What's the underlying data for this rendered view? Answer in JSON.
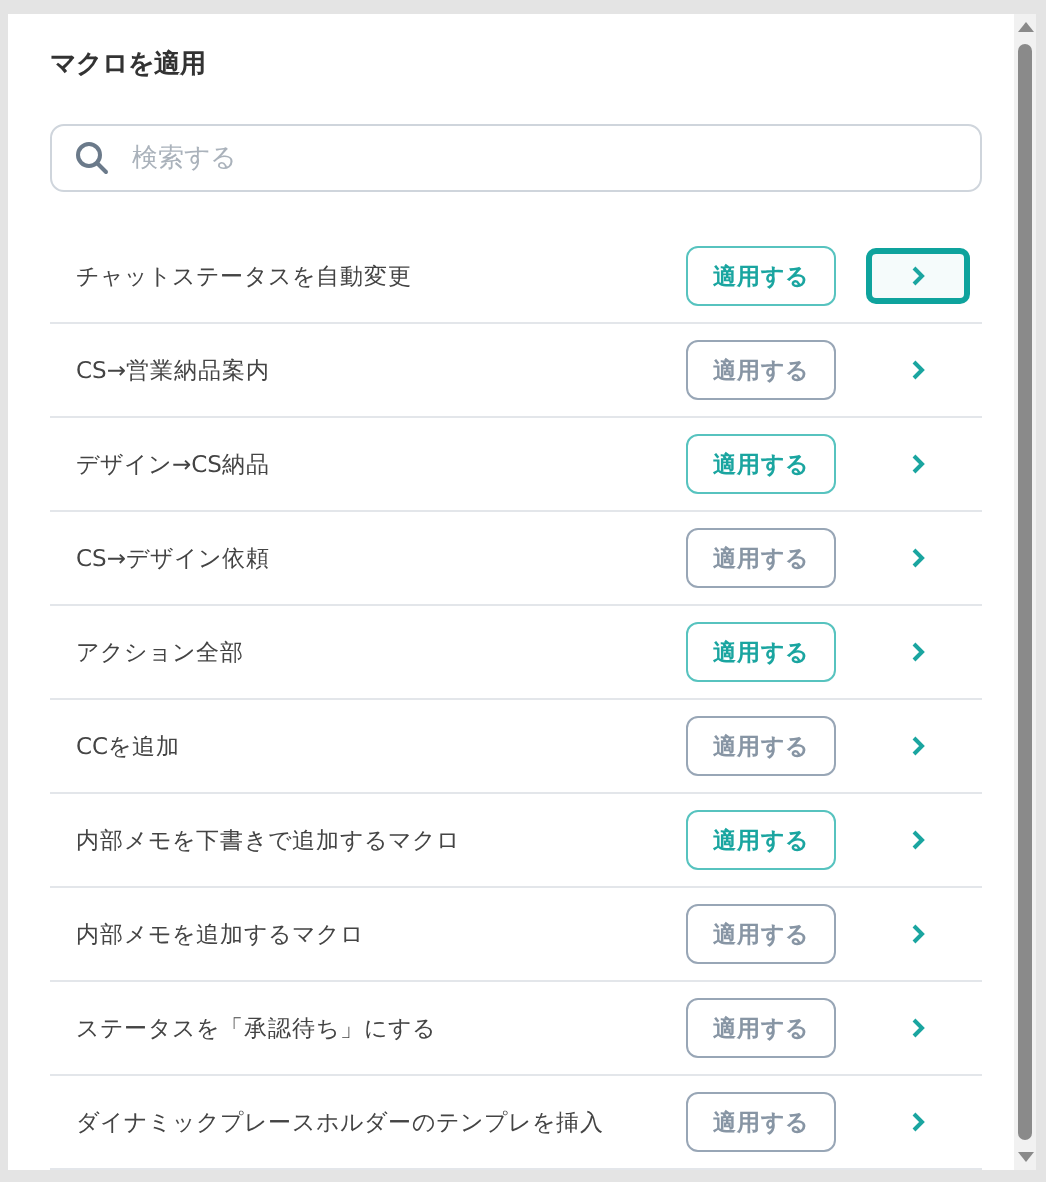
{
  "dialog": {
    "title": "マクロを適用"
  },
  "search": {
    "placeholder": "検索する"
  },
  "macros": [
    {
      "name": "チャットステータスを自動変更",
      "apply_label": "適用する",
      "enabled": true,
      "focused": true
    },
    {
      "name": "CS→営業納品案内",
      "apply_label": "適用する",
      "enabled": false,
      "focused": false
    },
    {
      "name": "デザイン→CS納品",
      "apply_label": "適用する",
      "enabled": true,
      "focused": false
    },
    {
      "name": "CS→デザイン依頼",
      "apply_label": "適用する",
      "enabled": false,
      "focused": false
    },
    {
      "name": "アクション全部",
      "apply_label": "適用する",
      "enabled": true,
      "focused": false
    },
    {
      "name": "CCを追加",
      "apply_label": "適用する",
      "enabled": false,
      "focused": false
    },
    {
      "name": "内部メモを下書きで追加するマクロ",
      "apply_label": "適用する",
      "enabled": true,
      "focused": false
    },
    {
      "name": "内部メモを追加するマクロ",
      "apply_label": "適用する",
      "enabled": false,
      "focused": false
    },
    {
      "name": "ステータスを「承認待ち」にする",
      "apply_label": "適用する",
      "enabled": false,
      "focused": false
    },
    {
      "name": "ダイナミックプレースホルダーのテンプレを挿入",
      "apply_label": "適用する",
      "enabled": false,
      "focused": false
    }
  ]
}
